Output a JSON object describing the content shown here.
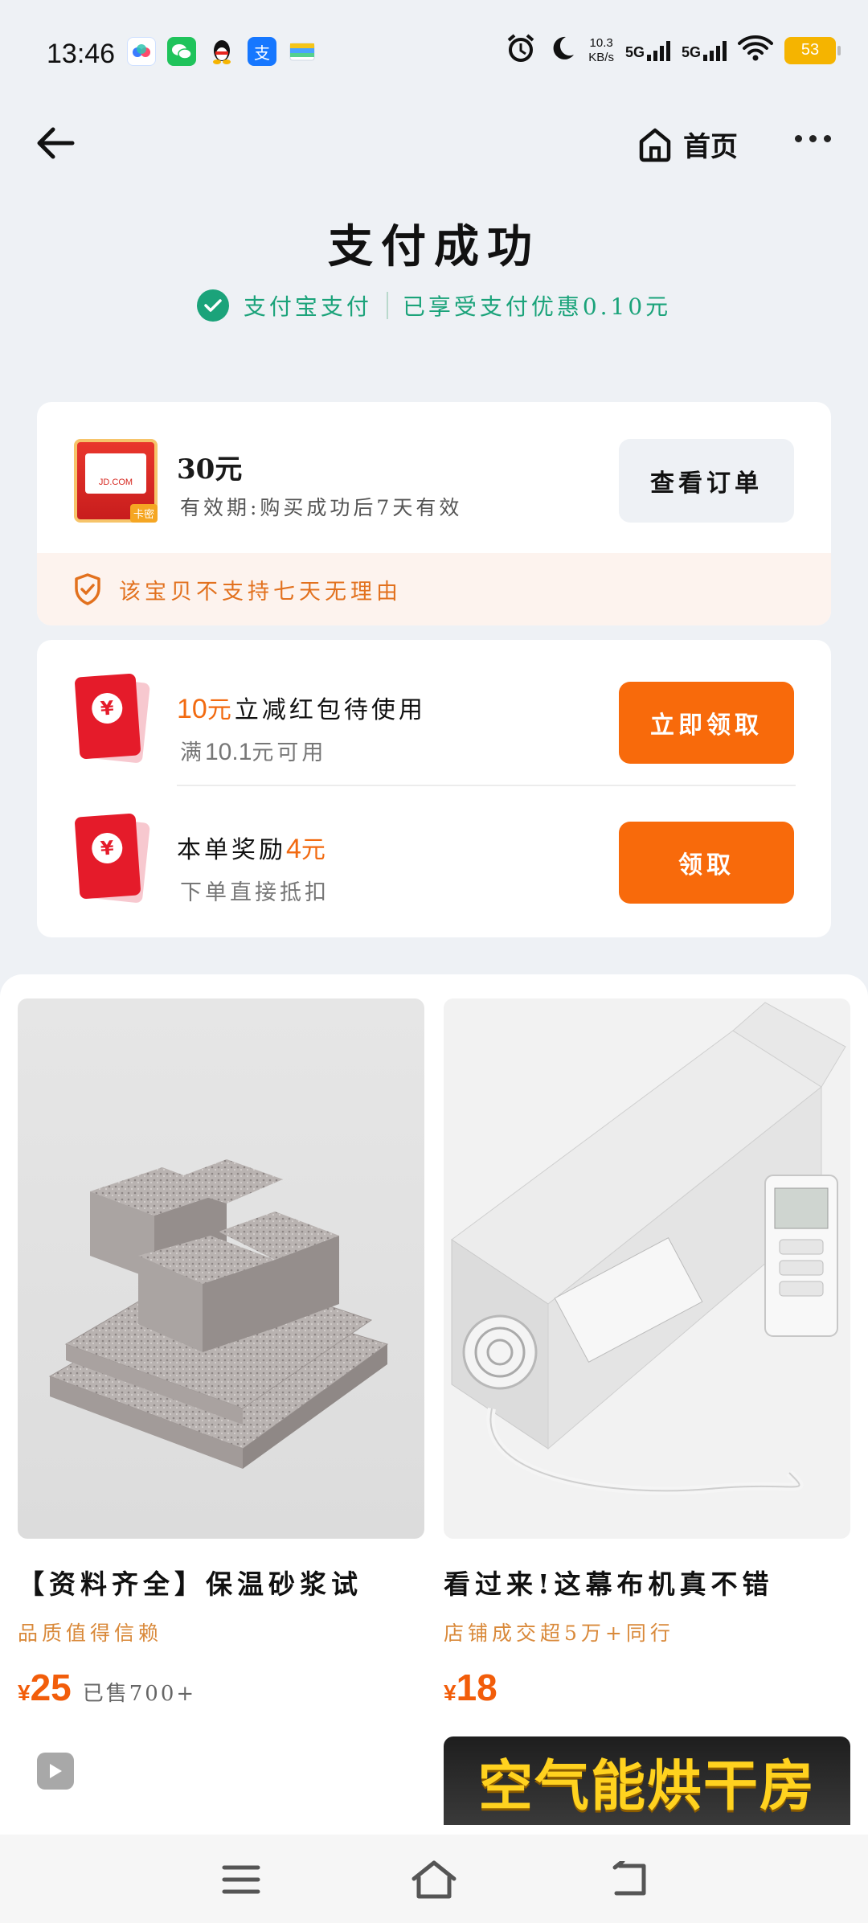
{
  "status_bar": {
    "time": "13:46",
    "net_speed_value": "10.3",
    "net_speed_unit": "KB/s",
    "signal1": "5G",
    "signal2": "5G",
    "battery": "53",
    "app_icons": [
      "baidu-netdisk-icon",
      "wechat-icon",
      "qq-icon",
      "alipay-icon",
      "wallet-icon"
    ]
  },
  "nav": {
    "home_label": "首页"
  },
  "header": {
    "title": "支付成功",
    "pay_method": "支付宝支付",
    "discount_text": "已享受支付优惠0.10元"
  },
  "order_card": {
    "amount_num": "30",
    "amount_unit": "元",
    "validity": "有效期:购买成功后7天有效",
    "view_order_label": "查看订单",
    "notice": "该宝贝不支持七天无理由",
    "thumb_text": "JD.COM",
    "thumb_tag": "卡密"
  },
  "coupons": [
    {
      "amount": "10",
      "unit": "元",
      "title_rest": "立减红包待使用",
      "sub_prefix": "满",
      "sub_amount": "10.1",
      "sub_rest": "元可用",
      "button": "立即领取"
    },
    {
      "title_prefix": "本单奖励",
      "amount": "4",
      "unit": "元",
      "sub": "下单直接抵扣",
      "button": "领取"
    }
  ],
  "products": [
    {
      "name": "【资料齐全】保温砂浆试",
      "tag": "品质值得信赖",
      "currency": "¥",
      "price": "25",
      "sold": "已售700+"
    },
    {
      "name": "看过来!这幕布机真不错",
      "tag": "店铺成交超5万+同行",
      "currency": "¥",
      "price": "18"
    }
  ],
  "banner": {
    "text": "空气能烘干房"
  },
  "colors": {
    "success_green": "#1ba37a",
    "accent_orange": "#f86a0b",
    "notice_orange": "#e2711e",
    "background": "#eef1f5"
  }
}
